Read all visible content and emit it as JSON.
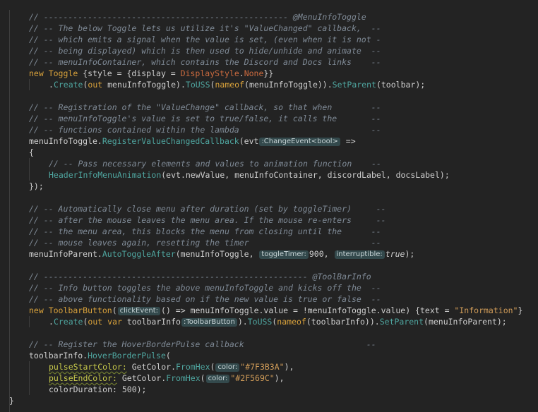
{
  "editor": {
    "background": "#232323",
    "lines": [
      {
        "indent": 1,
        "tokens": [
          {
            "t": "// -------------------------------------------------- @MenuInfoToggle",
            "c": "comment"
          }
        ]
      },
      {
        "indent": 1,
        "tokens": [
          {
            "t": "// -- The below Toggle lets us utilize it's \"ValueChanged\" callback,  --",
            "c": "comment"
          }
        ]
      },
      {
        "indent": 1,
        "tokens": [
          {
            "t": "// -- which emits a signal when the value is set, (even when it is not -",
            "c": "comment"
          }
        ]
      },
      {
        "indent": 1,
        "tokens": [
          {
            "t": "// -- being displayed) which is then used to hide/unhide and animate  --",
            "c": "comment"
          }
        ]
      },
      {
        "indent": 1,
        "tokens": [
          {
            "t": "// -- menuInfoContainer, which contains the Discord and Docs links    --",
            "c": "comment"
          }
        ]
      },
      {
        "indent": 1,
        "tokens": [
          {
            "t": "new ",
            "c": "keyword"
          },
          {
            "t": "Toggle",
            "c": "type"
          },
          {
            "t": " {style = {display = ",
            "c": "punct"
          },
          {
            "t": "DisplayStyle",
            "c": "enum"
          },
          {
            "t": ".",
            "c": "punct"
          },
          {
            "t": "None",
            "c": "enum"
          },
          {
            "t": "}}",
            "c": "punct"
          }
        ]
      },
      {
        "indent": 2,
        "tokens": [
          {
            "t": ".",
            "c": "punct"
          },
          {
            "t": "Create",
            "c": "method"
          },
          {
            "t": "(",
            "c": "punct"
          },
          {
            "t": "out",
            "c": "keyword"
          },
          {
            "t": " menuInfoToggle).",
            "c": "ident"
          },
          {
            "t": "ToUSS",
            "c": "method"
          },
          {
            "t": "(",
            "c": "punct"
          },
          {
            "t": "nameof",
            "c": "keyword"
          },
          {
            "t": "(menuInfoToggle)).",
            "c": "ident"
          },
          {
            "t": "SetParent",
            "c": "method"
          },
          {
            "t": "(toolbar);",
            "c": "ident"
          }
        ]
      },
      {
        "indent": 0,
        "tokens": []
      },
      {
        "indent": 1,
        "tokens": [
          {
            "t": "// -- Registration of the \"ValueChange\" callback, so that when        --",
            "c": "comment"
          }
        ]
      },
      {
        "indent": 1,
        "tokens": [
          {
            "t": "// -- menuInfoToggle's value is set to true/false, it calls the       --",
            "c": "comment"
          }
        ]
      },
      {
        "indent": 1,
        "tokens": [
          {
            "t": "// -- functions contained within the lambda                           --",
            "c": "comment"
          }
        ]
      },
      {
        "indent": 1,
        "tokens": [
          {
            "t": "menuInfoToggle.",
            "c": "ident"
          },
          {
            "t": "RegisterValueChangedCallback",
            "c": "method"
          },
          {
            "t": "(evt",
            "c": "ident"
          },
          {
            "t": ":ChangeEvent<bool>",
            "c": "hint"
          },
          {
            "t": " =>",
            "c": "punct"
          }
        ]
      },
      {
        "indent": 1,
        "tokens": [
          {
            "t": "{",
            "c": "punct"
          }
        ]
      },
      {
        "indent": 2,
        "tokens": [
          {
            "t": "// -- Pass necessary elements and values to animation function    --",
            "c": "comment"
          }
        ]
      },
      {
        "indent": 2,
        "tokens": [
          {
            "t": "HeaderInfoMenuAnimation",
            "c": "method"
          },
          {
            "t": "(evt.newValue, menuInfoContainer, discordLabel, docsLabel);",
            "c": "ident"
          }
        ]
      },
      {
        "indent": 1,
        "tokens": [
          {
            "t": "});",
            "c": "punct"
          }
        ]
      },
      {
        "indent": 0,
        "tokens": []
      },
      {
        "indent": 1,
        "tokens": [
          {
            "t": "// -- Automatically close menu after duration (set by toggleTimer)     --",
            "c": "comment"
          }
        ]
      },
      {
        "indent": 1,
        "tokens": [
          {
            "t": "// -- after the mouse leaves the menu area. If the mouse re-enters     --",
            "c": "comment"
          }
        ]
      },
      {
        "indent": 1,
        "tokens": [
          {
            "t": "// -- the menu area, this blocks the menu from closing until the      --",
            "c": "comment"
          }
        ]
      },
      {
        "indent": 1,
        "tokens": [
          {
            "t": "// -- mouse leaves again, resetting the timer                         --",
            "c": "comment"
          }
        ]
      },
      {
        "indent": 1,
        "tokens": [
          {
            "t": "menuInfoParent.",
            "c": "ident"
          },
          {
            "t": "AutoToggleAfter",
            "c": "method"
          },
          {
            "t": "(menuInfoToggle, ",
            "c": "ident"
          },
          {
            "t": "toggleTimer:",
            "c": "hint"
          },
          {
            "t": "900, ",
            "c": "number"
          },
          {
            "t": "interruptible:",
            "c": "hint"
          },
          {
            "t": "true",
            "c": "bool"
          },
          {
            "t": ");",
            "c": "punct"
          }
        ]
      },
      {
        "indent": 0,
        "tokens": []
      },
      {
        "indent": 1,
        "tokens": [
          {
            "t": "// ------------------------------------------------------ @ToolBarInfo",
            "c": "comment"
          }
        ]
      },
      {
        "indent": 1,
        "tokens": [
          {
            "t": "// -- Info button toggles the above menuInfoToggle and kicks off the  --",
            "c": "comment"
          }
        ]
      },
      {
        "indent": 1,
        "tokens": [
          {
            "t": "// -- above functionality based on if the new value is true or false  --",
            "c": "comment"
          }
        ]
      },
      {
        "indent": 1,
        "tokens": [
          {
            "t": "new ",
            "c": "keyword"
          },
          {
            "t": "ToolbarButton",
            "c": "type"
          },
          {
            "t": "(",
            "c": "punct"
          },
          {
            "t": "clickEvent:",
            "c": "hint"
          },
          {
            "t": "() => menuInfoToggle.value = !menuInfoToggle.value) {text = ",
            "c": "ident"
          },
          {
            "t": "\"Information\"",
            "c": "string"
          },
          {
            "t": "}",
            "c": "punct"
          }
        ]
      },
      {
        "indent": 2,
        "tokens": [
          {
            "t": ".",
            "c": "punct"
          },
          {
            "t": "Create",
            "c": "method"
          },
          {
            "t": "(",
            "c": "punct"
          },
          {
            "t": "out var",
            "c": "keyword"
          },
          {
            "t": " toolbarInfo",
            "c": "ident"
          },
          {
            "t": ":ToolbarButton",
            "c": "hint"
          },
          {
            "t": ").",
            "c": "punct"
          },
          {
            "t": "ToUSS",
            "c": "method"
          },
          {
            "t": "(",
            "c": "punct"
          },
          {
            "t": "nameof",
            "c": "keyword"
          },
          {
            "t": "(toolbarInfo)).",
            "c": "ident"
          },
          {
            "t": "SetParent",
            "c": "method"
          },
          {
            "t": "(menuInfoParent);",
            "c": "ident"
          }
        ]
      },
      {
        "indent": 0,
        "tokens": []
      },
      {
        "indent": 1,
        "tokens": [
          {
            "t": "// -- Register the HoverBorderPulse callback                         --",
            "c": "comment"
          }
        ]
      },
      {
        "indent": 1,
        "tokens": [
          {
            "t": "toolbarInfo.",
            "c": "ident"
          },
          {
            "t": "HoverBorderPulse",
            "c": "method"
          },
          {
            "t": "(",
            "c": "punct"
          }
        ]
      },
      {
        "indent": 2,
        "tokens": [
          {
            "t": "pulseStartColor:",
            "c": "param"
          },
          {
            "t": " GetColor.",
            "c": "ident"
          },
          {
            "t": "FromHex",
            "c": "method"
          },
          {
            "t": "(",
            "c": "punct"
          },
          {
            "t": "color:",
            "c": "hint"
          },
          {
            "t": "\"#7F3B3A\"",
            "c": "string"
          },
          {
            "t": "),",
            "c": "punct"
          }
        ]
      },
      {
        "indent": 2,
        "tokens": [
          {
            "t": "pulseEndColor:",
            "c": "param"
          },
          {
            "t": " GetColor.",
            "c": "ident"
          },
          {
            "t": "FromHex",
            "c": "method"
          },
          {
            "t": "(",
            "c": "punct"
          },
          {
            "t": "color:",
            "c": "hint"
          },
          {
            "t": "\"#2F569C\"",
            "c": "string"
          },
          {
            "t": "),",
            "c": "punct"
          }
        ]
      },
      {
        "indent": 2,
        "tokens": [
          {
            "t": "colorDuration: 500);",
            "c": "ident"
          }
        ]
      },
      {
        "indent": 0,
        "tokens": [
          {
            "t": "}",
            "c": "punct"
          }
        ]
      }
    ]
  }
}
